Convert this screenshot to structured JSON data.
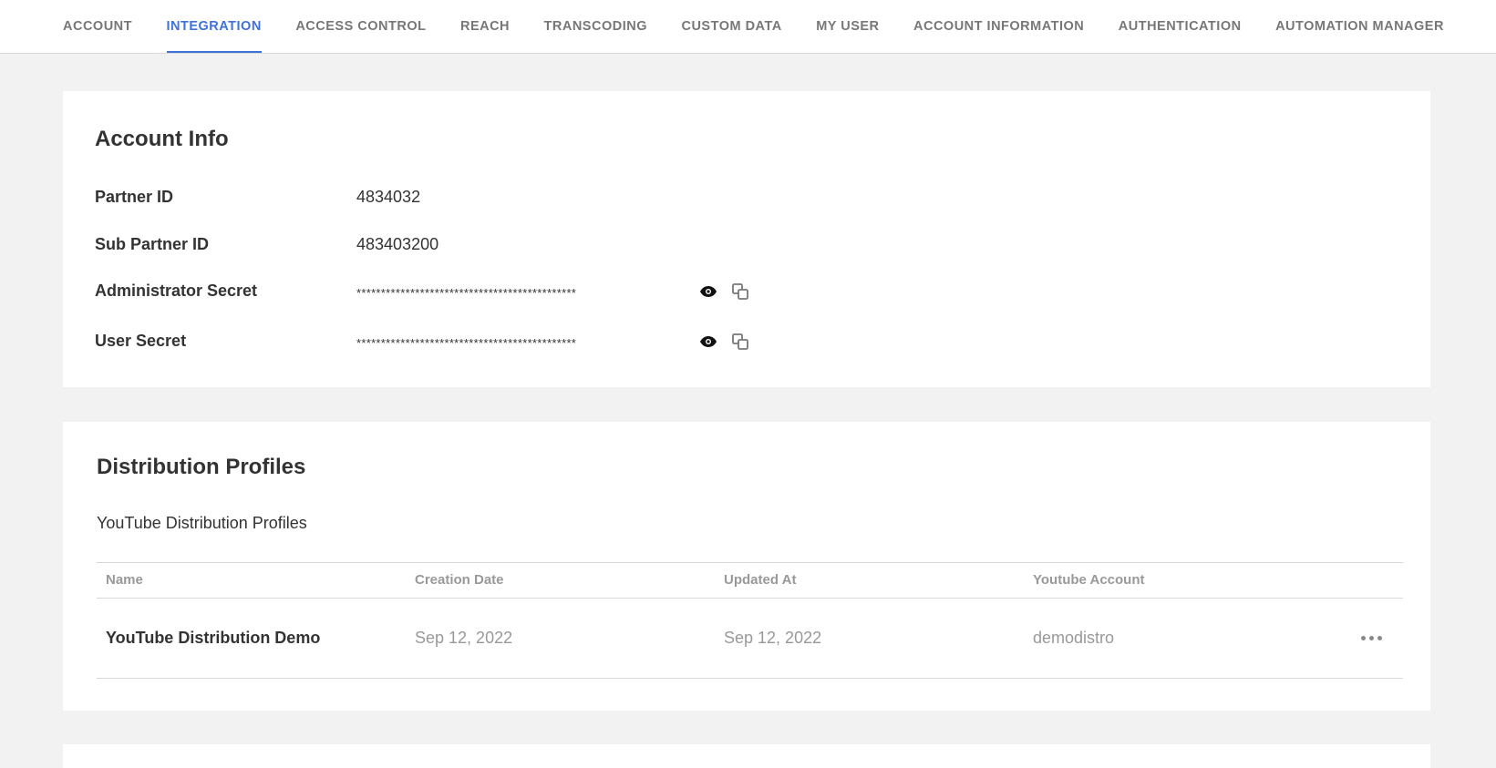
{
  "nav": {
    "tabs": [
      {
        "label": "ACCOUNT",
        "active": false
      },
      {
        "label": "INTEGRATION",
        "active": true
      },
      {
        "label": "ACCESS CONTROL",
        "active": false
      },
      {
        "label": "REACH",
        "active": false
      },
      {
        "label": "TRANSCODING",
        "active": false
      },
      {
        "label": "CUSTOM DATA",
        "active": false
      },
      {
        "label": "MY USER",
        "active": false
      },
      {
        "label": "ACCOUNT INFORMATION",
        "active": false
      },
      {
        "label": "AUTHENTICATION",
        "active": false
      },
      {
        "label": "AUTOMATION MANAGER",
        "active": false
      }
    ],
    "accent_color": "#3f72d9"
  },
  "account_info": {
    "title": "Account Info",
    "partner_id_label": "Partner ID",
    "partner_id_value": "4834032",
    "sub_partner_id_label": "Sub Partner ID",
    "sub_partner_id_value": "483403200",
    "admin_secret_label": "Administrator Secret",
    "admin_secret_value": "*********************************************",
    "user_secret_label": "User Secret",
    "user_secret_value": "*********************************************",
    "icons": {
      "reveal": "eye-icon",
      "copy": "copy-icon"
    }
  },
  "distribution": {
    "title": "Distribution Profiles",
    "subtitle": "YouTube Distribution Profiles",
    "columns": [
      "Name",
      "Creation Date",
      "Updated At",
      "Youtube Account"
    ],
    "rows": [
      {
        "name": "YouTube Distribution Demo",
        "created": "Sep 12, 2022",
        "updated": "Sep 12, 2022",
        "account": "demodistro"
      }
    ],
    "row_actions_icon": "more-horizontal-icon"
  }
}
